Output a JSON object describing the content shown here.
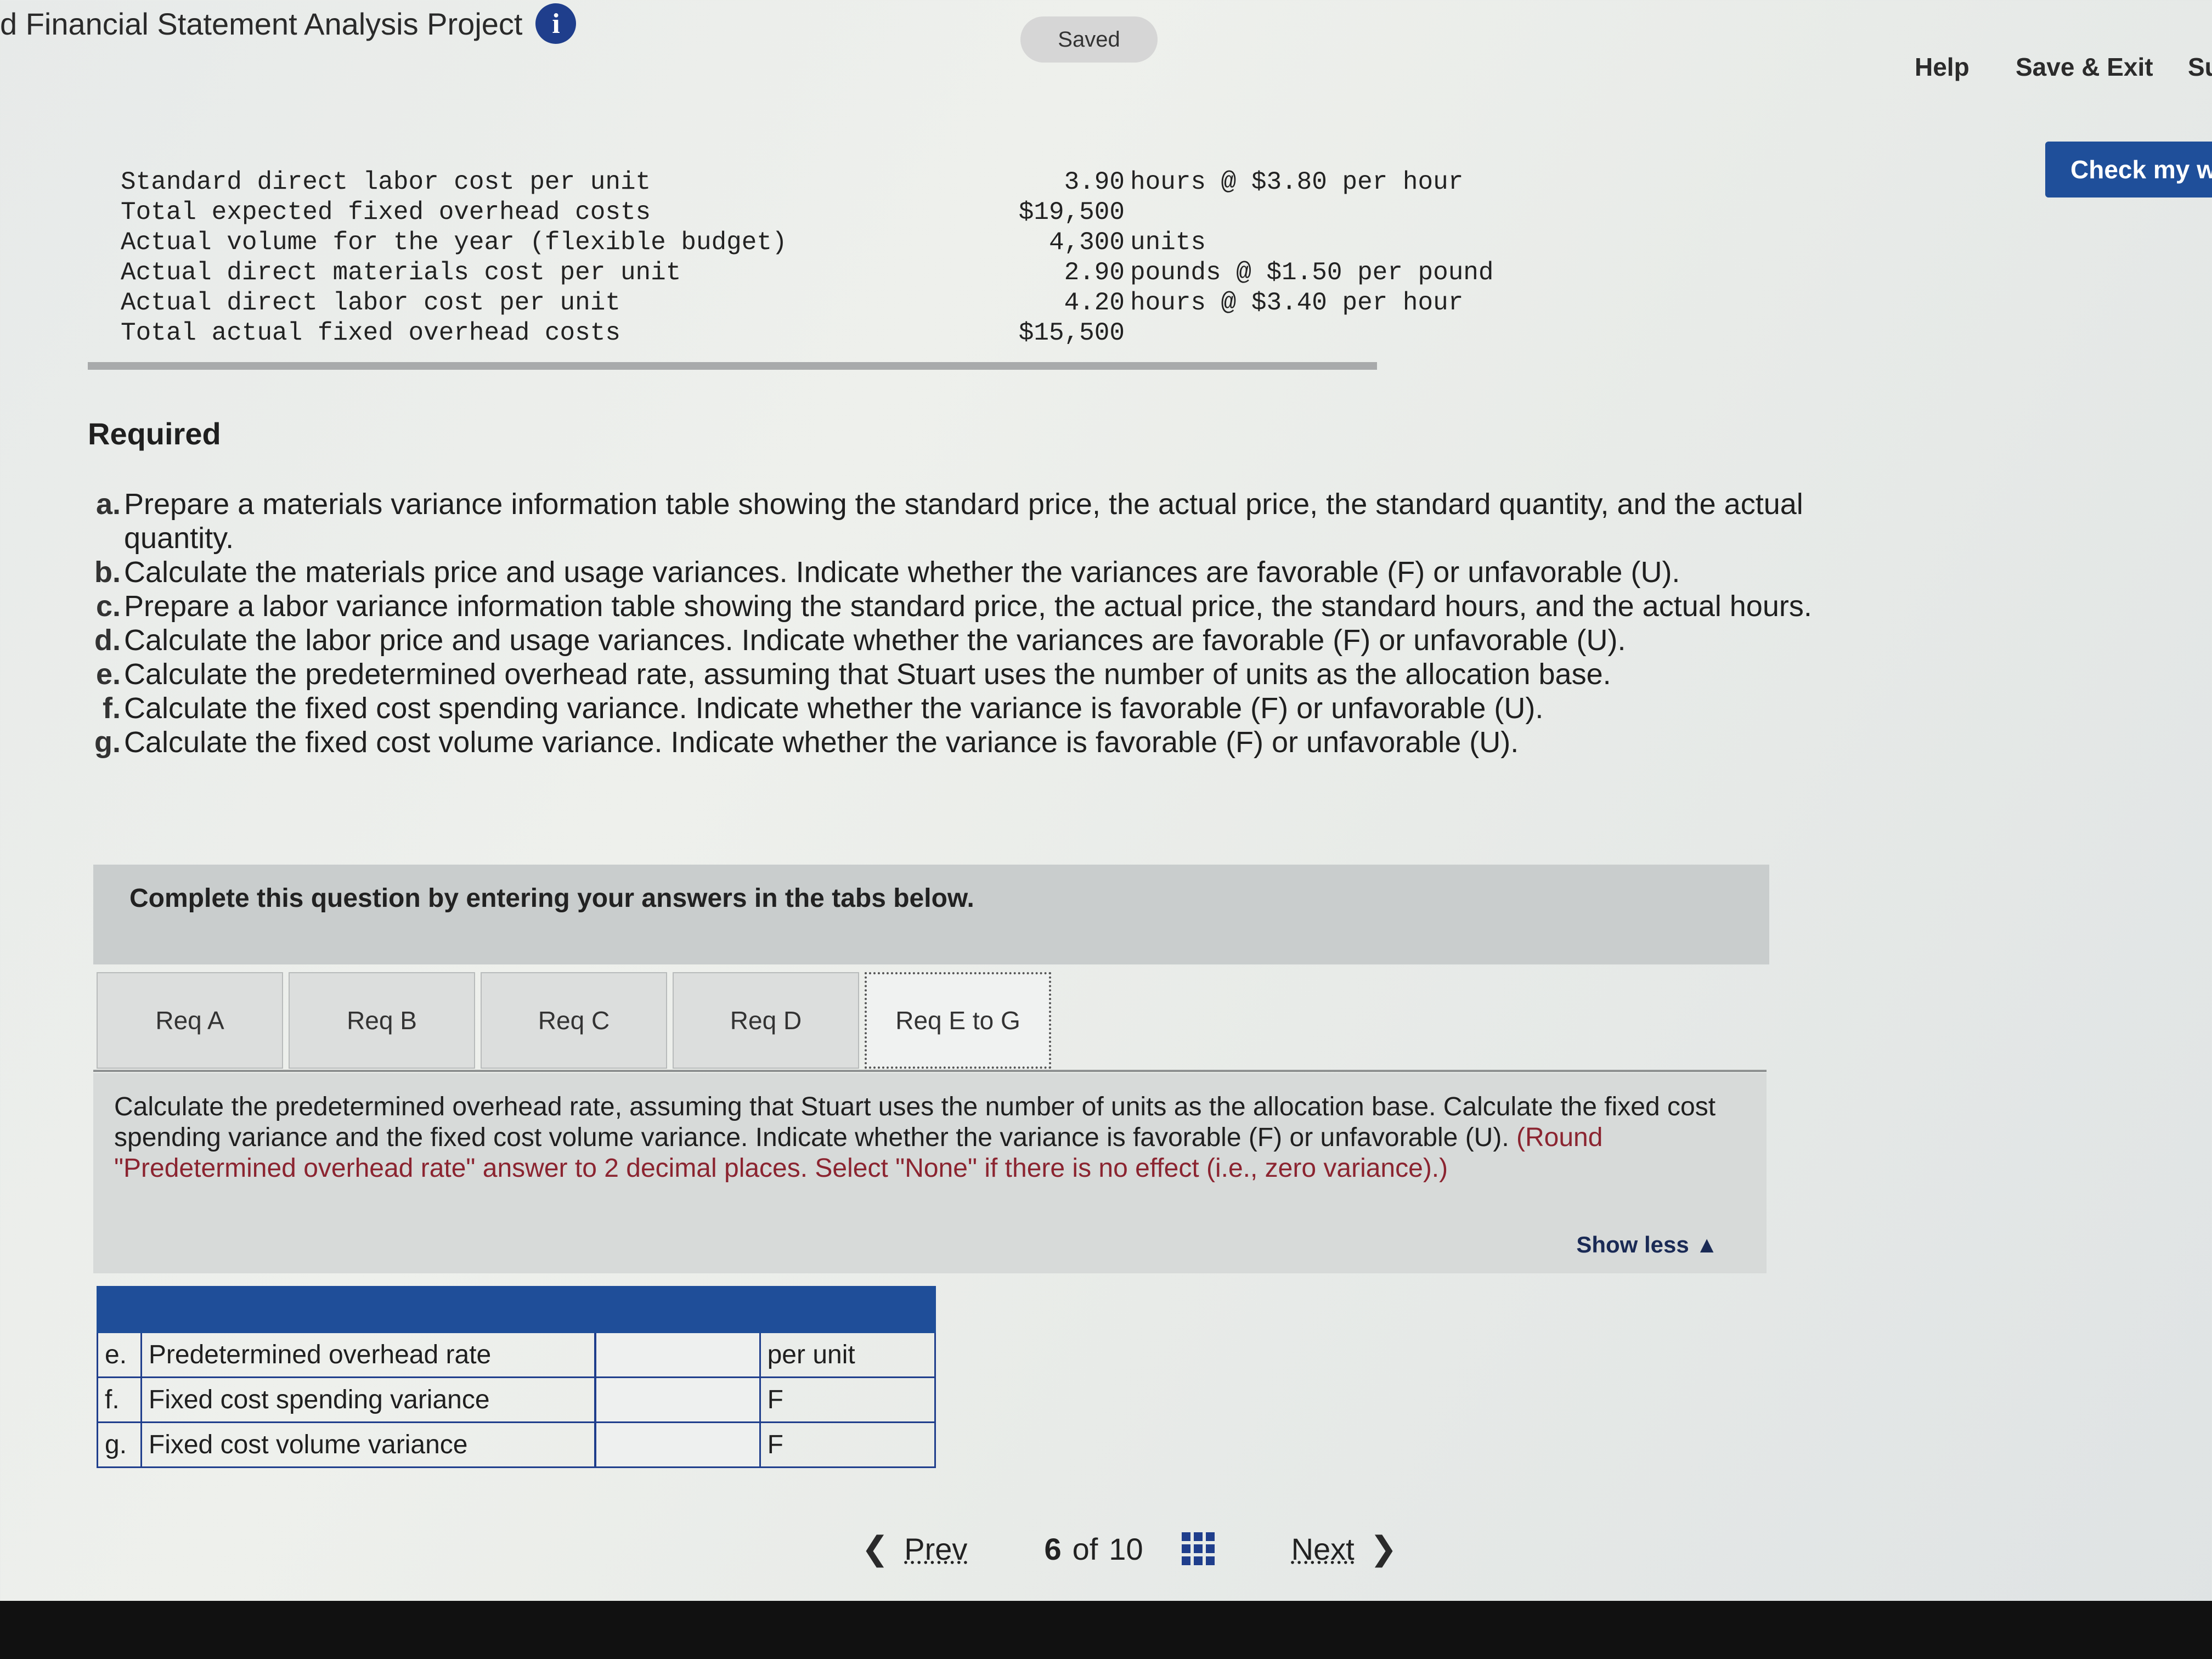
{
  "header": {
    "title": "d Financial Statement Analysis Project",
    "saved": "Saved",
    "help": "Help",
    "save_exit": "Save & Exit",
    "submit_partial": "Su",
    "check_my_work": "Check my w"
  },
  "data_table": [
    {
      "label": "Standard direct labor cost per unit",
      "amount": "3.90",
      "unit": "hours @ $3.80 per hour"
    },
    {
      "label": "Total expected fixed overhead costs",
      "amount": "$19,500",
      "unit": ""
    },
    {
      "label": "Actual volume for the year (flexible budget)",
      "amount": "4,300",
      "unit": "units"
    },
    {
      "label": "Actual direct materials cost per unit",
      "amount": "2.90",
      "unit": "pounds @ $1.50 per pound"
    },
    {
      "label": "Actual direct labor cost per unit",
      "amount": "4.20",
      "unit": "hours @ $3.40 per hour"
    },
    {
      "label": "Total actual fixed overhead costs",
      "amount": "$15,500",
      "unit": ""
    }
  ],
  "required": {
    "heading": "Required",
    "items": [
      {
        "letter": "a.",
        "text": "Prepare a materials variance information table showing the standard price, the actual price, the standard quantity, and the actual quantity."
      },
      {
        "letter": "b.",
        "text": "Calculate the materials price and usage variances. Indicate whether the variances are favorable (F) or unfavorable (U)."
      },
      {
        "letter": "c.",
        "text": "Prepare a labor variance information table showing the standard price, the actual price, the standard hours, and the actual hours."
      },
      {
        "letter": "d.",
        "text": "Calculate the labor price and usage variances. Indicate whether the variances are favorable (F) or unfavorable (U)."
      },
      {
        "letter": "e.",
        "text": "Calculate the predetermined overhead rate, assuming that Stuart uses the number of units as the allocation base."
      },
      {
        "letter": "f.",
        "text": "Calculate the fixed cost spending variance. Indicate whether the variance is favorable (F) or unfavorable (U)."
      },
      {
        "letter": "g.",
        "text": "Calculate the fixed cost volume variance. Indicate whether the variance is favorable (F) or unfavorable (U)."
      }
    ]
  },
  "question_box": {
    "text": "Complete this question by entering your answers in the tabs below."
  },
  "tabs": [
    "Req A",
    "Req B",
    "Req C",
    "Req D",
    "Req E to G"
  ],
  "active_tab": "Req E to G",
  "panel": {
    "instruction": "Calculate the predetermined overhead rate, assuming that Stuart uses the number of units as the allocation base. Calculate the fixed cost spending variance and the fixed cost volume variance. Indicate whether the variance is favorable (F) or unfavorable (U).",
    "note": "(Round \"Predetermined overhead rate\" answer to 2 decimal places. Select \"None\" if there is no effect (i.e., zero variance).)",
    "show_less": "Show less ▲"
  },
  "answer_table": {
    "rows": [
      {
        "letter": "e.",
        "label": "Predetermined overhead rate",
        "value": "",
        "unit": "per unit"
      },
      {
        "letter": "f.",
        "label": "Fixed cost spending variance",
        "value": "",
        "unit": "F"
      },
      {
        "letter": "g.",
        "label": "Fixed cost volume variance",
        "value": "",
        "unit": "F"
      }
    ]
  },
  "pagination": {
    "prev": "Prev",
    "current": "6",
    "of": "of",
    "total": "10",
    "next": "Next"
  },
  "colors": {
    "accent": "#1f4e99",
    "note_red": "#8b2430"
  }
}
